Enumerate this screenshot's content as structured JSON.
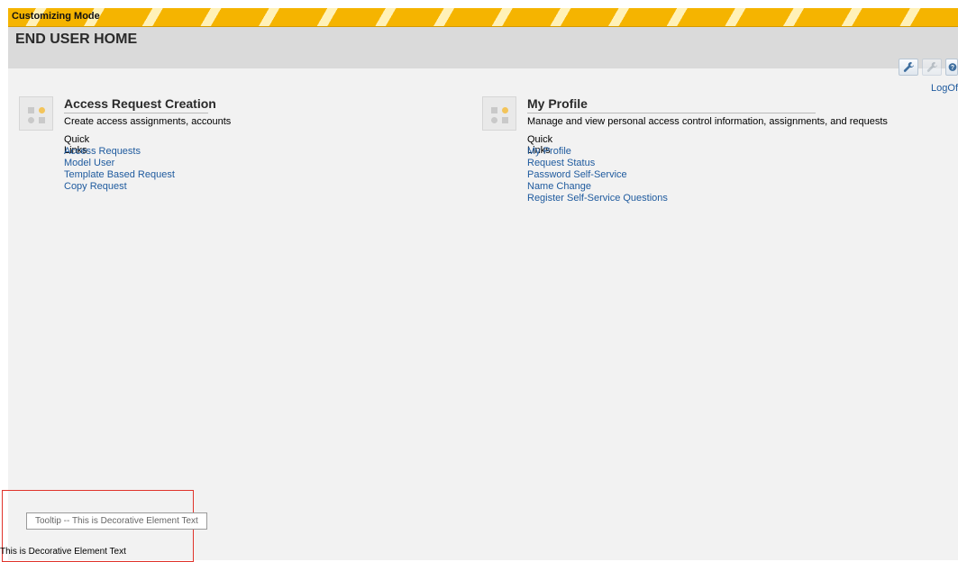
{
  "customizing_bar": {
    "label": "Customizing Mode"
  },
  "header": {
    "title": "END USER HOME"
  },
  "toolbar": {
    "buttons": [
      {
        "icon": "wrench-icon",
        "enabled": true
      },
      {
        "icon": "wrench-icon",
        "enabled": false
      },
      {
        "icon": "help-icon",
        "enabled": true
      }
    ]
  },
  "logoff": {
    "label": "LogOf"
  },
  "cards": [
    {
      "title": "Access Request Creation",
      "description": "Create access assignments, accounts",
      "quick_links_label": "Quick Links",
      "links": [
        "Access Requests",
        "Model User",
        "Template Based Request",
        "Copy Request"
      ]
    },
    {
      "title": "My Profile",
      "description": "Manage and view personal access control information, assignments, and requests",
      "quick_links_label": "Quick Links",
      "links": [
        "My Profile",
        "Request Status",
        "Password Self-Service",
        "Name Change",
        "Register Self-Service Questions"
      ]
    }
  ],
  "tooltip": {
    "text": "Tooltip -- This is Decorative Element Text"
  },
  "decorative_text": "This is Decorative Element Text",
  "colors": {
    "link": "#1e5a9e",
    "bar_stripe": "#f5b400",
    "header_bg": "#dadada",
    "highlight_border": "#e0332b"
  }
}
